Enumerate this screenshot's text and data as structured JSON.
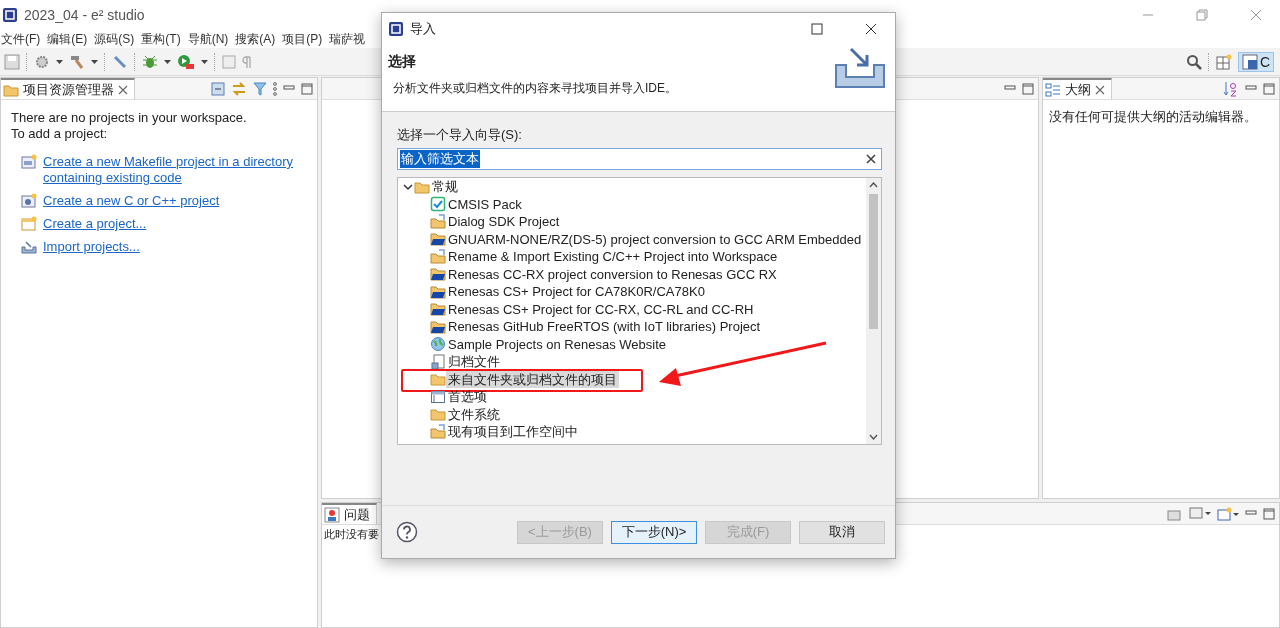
{
  "window": {
    "title": "2023_04 - e² studio"
  },
  "menu": [
    "文件(F)",
    "编辑(E)",
    "源码(S)",
    "重构(T)",
    "导航(N)",
    "搜索(A)",
    "项目(P)",
    "瑞萨视"
  ],
  "perspective": {
    "label": "C",
    "selected": true
  },
  "project_explorer": {
    "tab": "项目资源管理器",
    "message": [
      "There are no projects in your workspace.",
      "To add a project:"
    ],
    "links": [
      {
        "kind": "makefile",
        "text": "Create a new Makefile project in a directory containing existing code"
      },
      {
        "kind": "cproject",
        "text": "Create a new C or C++ project"
      },
      {
        "kind": "project",
        "text": "Create a project..."
      },
      {
        "kind": "import",
        "text": "Import projects..."
      }
    ]
  },
  "outline": {
    "tab": "大纲",
    "message": "没有任何可提供大纲的活动编辑器。"
  },
  "problems": {
    "tab": "问题",
    "message": "此时没有要"
  },
  "dialog": {
    "title": "导入",
    "heading": "选择",
    "description": "分析文件夹或归档文件的内容来寻找项目并导入IDE。",
    "wizard_label": "选择一个导入向导(S):",
    "filter": {
      "value": "输入筛选文本",
      "text_selected": true
    },
    "tree": [
      {
        "label": "常规",
        "expanded": true,
        "children": [
          {
            "label": "CMSIS Pack",
            "kind": "check",
            "selected": false
          },
          {
            "label": "Dialog SDK Project",
            "kind": "import-folder",
            "selected": false
          },
          {
            "label": "GNUARM-NONE/RZ(DS-5)  project conversion to GCC ARM Embedded",
            "kind": "blue-folder",
            "selected": false
          },
          {
            "label": "Rename & Import Existing C/C++ Project into Workspace",
            "kind": "import-folder",
            "selected": false
          },
          {
            "label": "Renesas CC-RX project conversion to Renesas GCC RX",
            "kind": "blue-folder",
            "selected": false
          },
          {
            "label": "Renesas CS+ Project for CA78K0R/CA78K0",
            "kind": "blue-folder",
            "selected": false
          },
          {
            "label": "Renesas CS+ Project for CC-RX, CC-RL and CC-RH",
            "kind": "blue-folder",
            "selected": false
          },
          {
            "label": "Renesas GitHub FreeRTOS (with IoT libraries) Project",
            "kind": "blue-folder",
            "selected": false
          },
          {
            "label": "Sample Projects on Renesas Website",
            "kind": "globe",
            "selected": false
          },
          {
            "label": "归档文件",
            "kind": "archive",
            "selected": false
          },
          {
            "label": "来自文件夹或归档文件的项目",
            "kind": "folder",
            "selected": true,
            "annotated": true
          },
          {
            "label": "首选项",
            "kind": "prefs",
            "selected": false
          },
          {
            "label": "文件系统",
            "kind": "folder",
            "selected": false
          },
          {
            "label": "现有项目到工作空间中",
            "kind": "import-folder",
            "selected": false
          }
        ]
      }
    ],
    "buttons": [
      {
        "label": "<上一步(B)",
        "disabled": true,
        "default": false
      },
      {
        "label": "下一步(N)>",
        "disabled": false,
        "default": true
      },
      {
        "label": "完成(F)",
        "disabled": true,
        "default": false
      },
      {
        "label": "取消",
        "disabled": false,
        "default": false
      }
    ]
  }
}
